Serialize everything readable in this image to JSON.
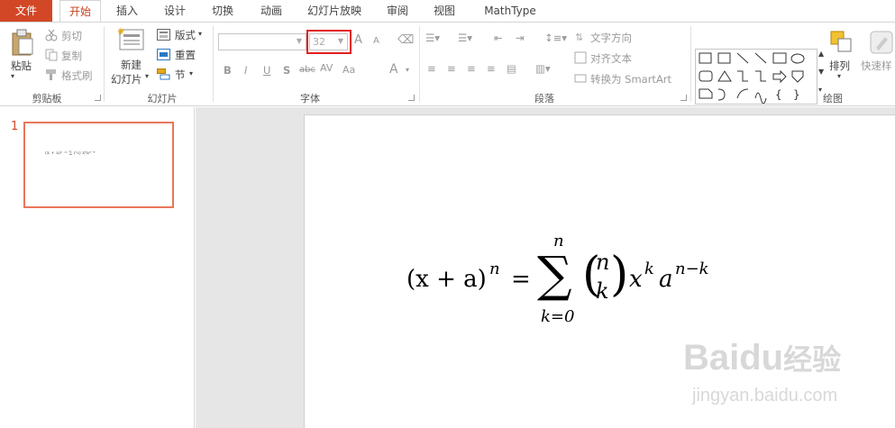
{
  "tabs": [
    "文件",
    "开始",
    "插入",
    "设计",
    "切换",
    "动画",
    "幻灯片放映",
    "审阅",
    "视图",
    "MathType"
  ],
  "clipboard": {
    "paste": "粘贴",
    "cut": "剪切",
    "copy": "复制",
    "format_painter": "格式刷",
    "label": "剪贴板"
  },
  "slides_group": {
    "new_slide_line1": "新建",
    "new_slide_line2": "幻灯片",
    "layout": "版式",
    "reset": "重置",
    "section": "节",
    "label": "幻灯片"
  },
  "font": {
    "size": "32",
    "label": "字体",
    "bold": "B",
    "italic": "I",
    "underline": "U",
    "shadow": "S",
    "strike": "abc",
    "spacing": "AV",
    "grow": "A",
    "shrink": "A",
    "color": "A"
  },
  "paragraph": {
    "text_direction": "文字方向",
    "align_text": "对齐文本",
    "convert_smartart": "转换为 SmartArt",
    "label": "段落"
  },
  "drawing": {
    "arrange": "排列",
    "quick_styles": "快速样",
    "label": "绘图"
  },
  "thumbnail": {
    "number": "1",
    "formula": "(x + a)ⁿ = ∑ (ⁿₖ) xᵏaⁿ⁻ᵏ"
  },
  "equation": {
    "lhs": "(x + a)",
    "lhs_exp": "n",
    "equals": "=",
    "sum": "∑",
    "sum_upper": "n",
    "sum_lower": "k=0",
    "binom_top": "n",
    "binom_bottom": "k",
    "x": "x",
    "x_exp": "k",
    "a": "a",
    "a_exp": "n−k"
  },
  "watermark": {
    "brand": "Baidu",
    "brand_cn": "经验",
    "url": "jingyan.baidu.com"
  },
  "colors": {
    "accent": "#d24726",
    "highlight": "#e0201f"
  }
}
